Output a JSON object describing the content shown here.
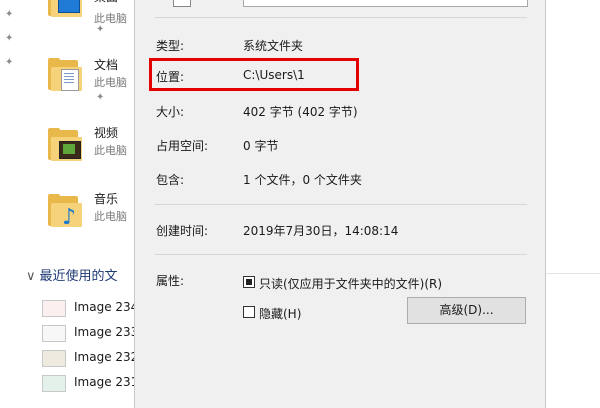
{
  "explorer": {
    "quick_access": [
      {
        "name": "桌面",
        "location": "此电脑",
        "icon": "desktop-folder-icon"
      },
      {
        "name": "文档",
        "location": "此电脑",
        "icon": "documents-folder-icon"
      },
      {
        "name": "视频",
        "location": "此电脑",
        "icon": "videos-folder-icon"
      },
      {
        "name": "音乐",
        "location": "此电脑",
        "icon": "music-folder-icon"
      }
    ],
    "recent_section": {
      "chevron": "∨",
      "title": "最近使用的文"
    },
    "recent_files": [
      {
        "name": "Image 234"
      },
      {
        "name": "Image 233"
      },
      {
        "name": "Image 232"
      },
      {
        "name": "Image 231"
      }
    ]
  },
  "properties": {
    "type": {
      "label": "类型:",
      "value": "系统文件夹"
    },
    "location": {
      "label": "位置:",
      "value": "C:\\Users\\1"
    },
    "size": {
      "label": "大小:",
      "value": "402 字节 (402 字节)"
    },
    "size_on_disk": {
      "label": "占用空间:",
      "value": "0 字节"
    },
    "contains": {
      "label": "包含:",
      "value": "1 个文件，0 个文件夹"
    },
    "created": {
      "label": "创建时间:",
      "value": "2019年7月30日，14:08:14"
    },
    "attributes": {
      "label": "属性:",
      "readonly": {
        "label": "只读(仅应用于文件夹中的文件)(R)",
        "checked": true
      },
      "hidden": {
        "label": "隐藏(H)",
        "checked": false
      },
      "advanced_button": "高级(D)..."
    }
  },
  "colors": {
    "highlight": "#e20000",
    "folder": "#f6d27a",
    "section_text": "#1e3a73"
  }
}
